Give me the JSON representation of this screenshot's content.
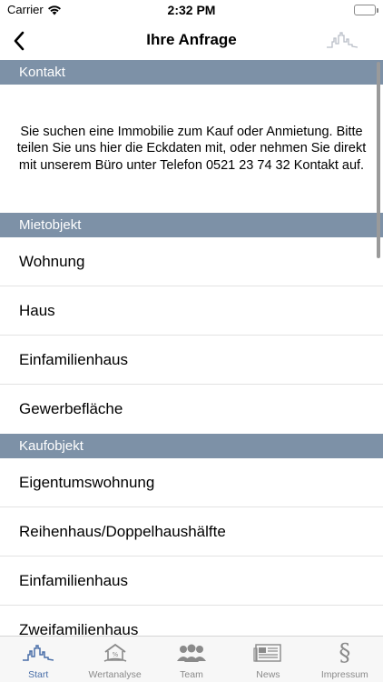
{
  "status": {
    "carrier": "Carrier",
    "time": "2:32 PM"
  },
  "nav": {
    "title": "Ihre Anfrage"
  },
  "sections": {
    "kontakt": {
      "title": "Kontakt",
      "text": "Sie suchen eine Immobilie zum Kauf oder Anmietung. Bitte teilen Sie uns hier die Eckdaten mit, oder nehmen Sie direkt mit unserem Büro unter Telefon 0521 23 74 32 Kontakt auf."
    },
    "mietobjekt": {
      "title": "Mietobjekt",
      "items": [
        "Wohnung",
        "Haus",
        "Einfamilienhaus",
        "Gewerbefläche"
      ]
    },
    "kaufobjekt": {
      "title": "Kaufobjekt",
      "items": [
        "Eigentumswohnung",
        "Reihenhaus/Doppelhaushälfte",
        "Einfamilienhaus",
        "Zweifamilienhaus"
      ]
    }
  },
  "tabs": [
    {
      "label": "Start",
      "icon": "skyline-icon",
      "active": true
    },
    {
      "label": "Wertanalyse",
      "icon": "house-percent-icon",
      "active": false
    },
    {
      "label": "Team",
      "icon": "team-icon",
      "active": false
    },
    {
      "label": "News",
      "icon": "newspaper-icon",
      "active": false
    },
    {
      "label": "Impressum",
      "icon": "paragraph-icon",
      "active": false
    }
  ],
  "colors": {
    "section_header": "#7d91a7",
    "tab_active": "#4a6fa8",
    "tab_inactive": "#8a8a8a"
  }
}
